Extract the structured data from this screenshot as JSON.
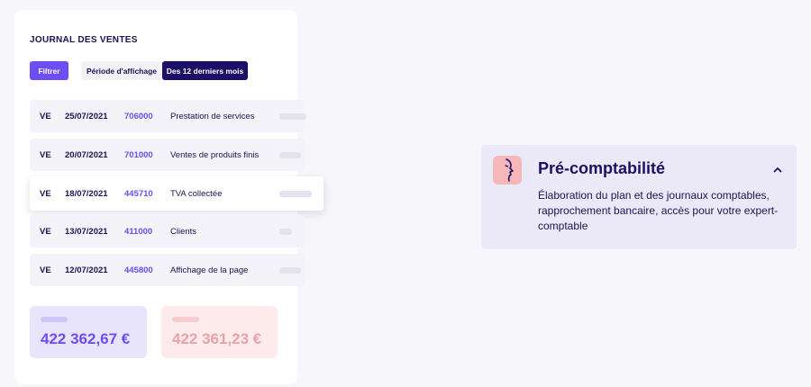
{
  "journal": {
    "title": "JOURNAL DES VENTES",
    "filter_label": "Filtrer",
    "period_label": "Période d'affichage",
    "period_value": "Des 12 derniers mois",
    "entries": [
      {
        "journal": "VE",
        "date": "25/07/2021",
        "account": "706000",
        "label": "Prestation de services"
      },
      {
        "journal": "VE",
        "date": "20/07/2021",
        "account": "701000",
        "label": "Ventes de produits finis"
      },
      {
        "journal": "VE",
        "date": "18/07/2021",
        "account": "445710",
        "label": "TVA collectée"
      },
      {
        "journal": "VE",
        "date": "13/07/2021",
        "account": "411000",
        "label": "Clients"
      },
      {
        "journal": "VE",
        "date": "12/07/2021",
        "account": "445800",
        "label": "Affichage de la page"
      }
    ],
    "totals": {
      "debit": "422 362,67 €",
      "credit": "422 361,23 €"
    }
  },
  "feature": {
    "title": "Pré-comptabilité",
    "description": "Élaboration du plan et des journaux comptables, rapprochement bancaire, accès pour votre expert-comptable",
    "icon": "face-profile-icon",
    "toggle_icon": "chevron-up-icon"
  },
  "colors": {
    "accent": "#6c4ef2",
    "navy": "#1b1066",
    "pink": "#f6b7b9",
    "feature_bg": "#ebe9f8"
  }
}
